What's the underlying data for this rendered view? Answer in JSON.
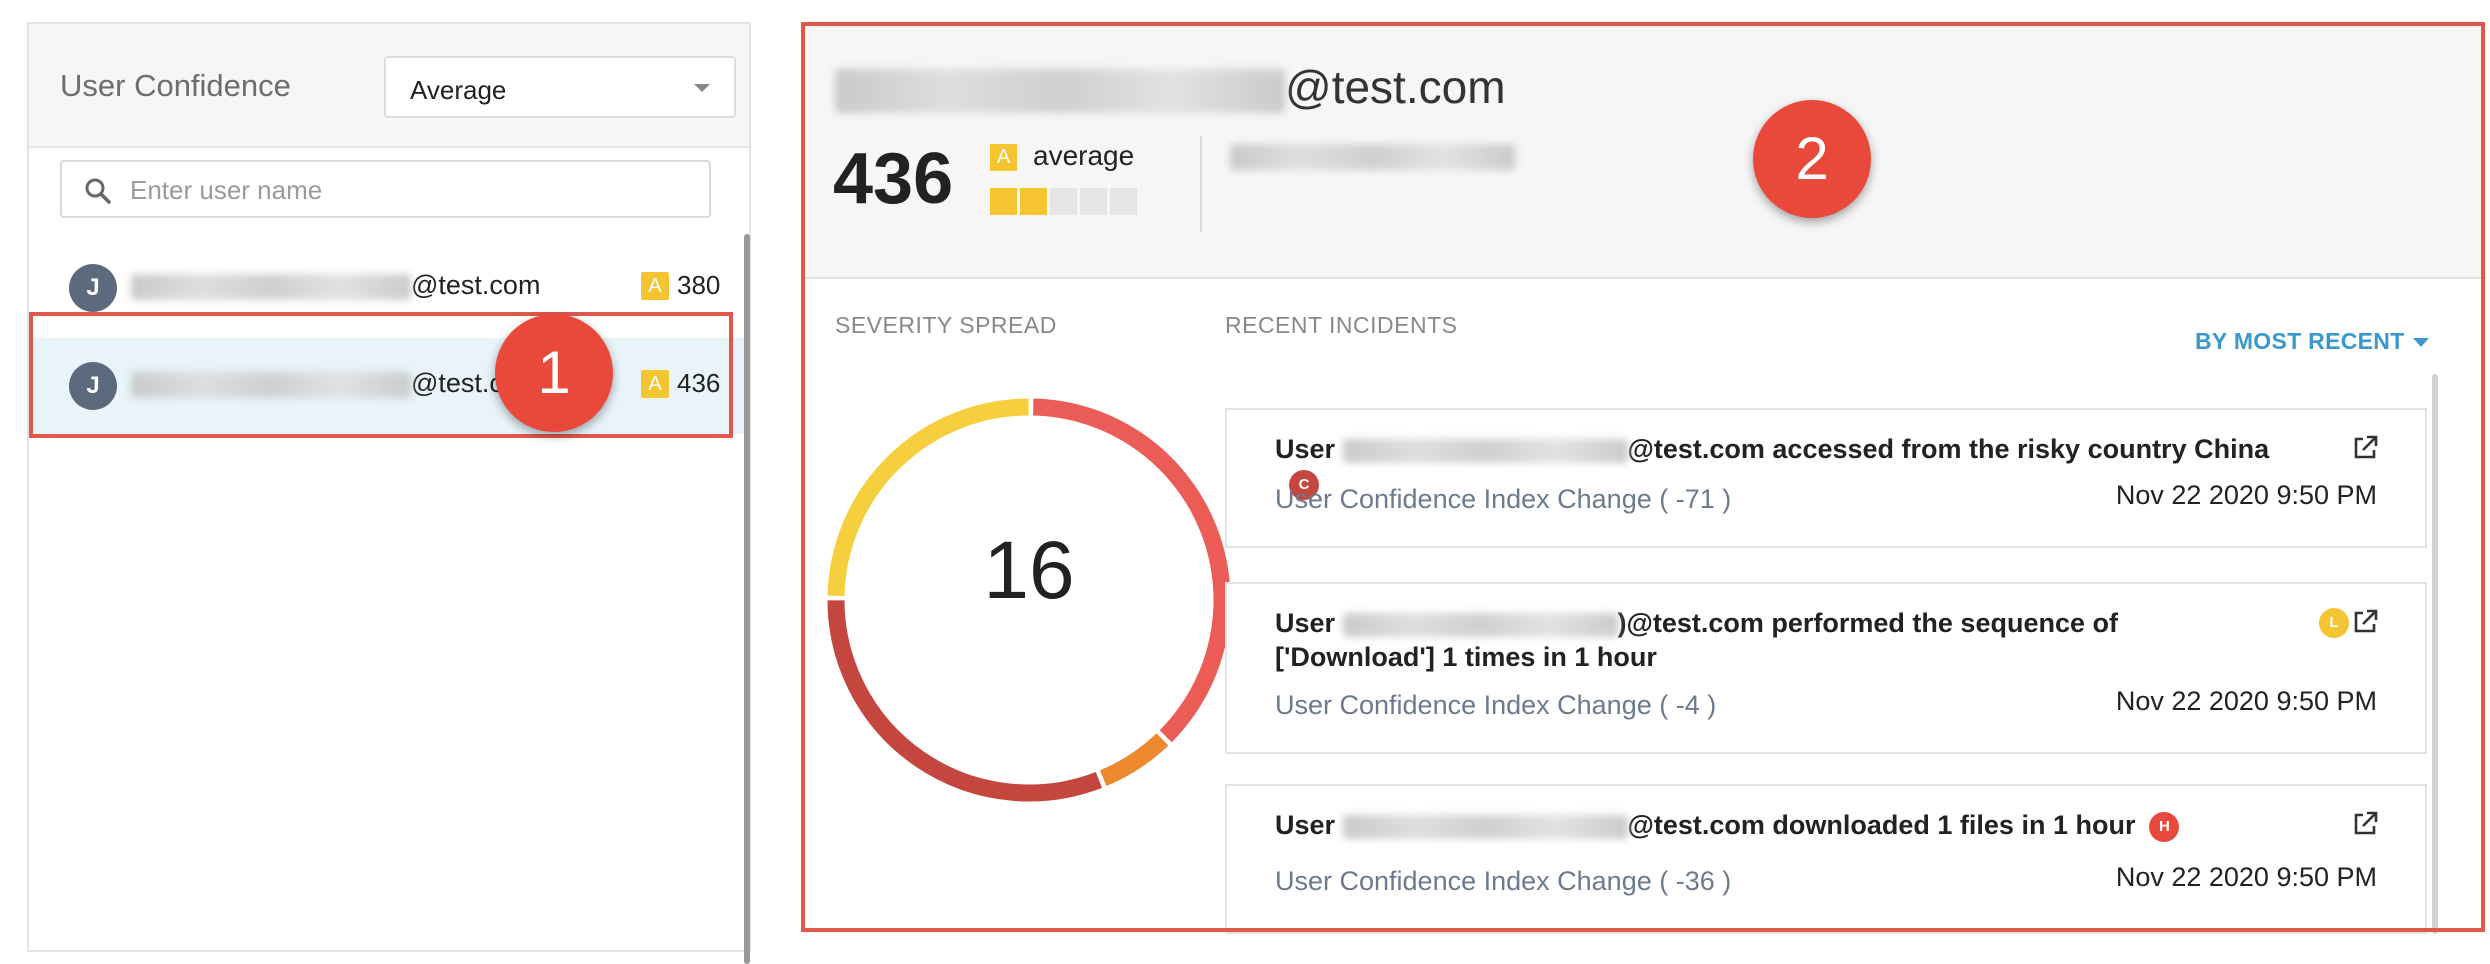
{
  "left_panel": {
    "title": "User Confidence",
    "filter": {
      "selected": "Average"
    },
    "search": {
      "placeholder": "Enter user name",
      "value": ""
    },
    "users": [
      {
        "initial": "J",
        "email_suffix": "@test.com",
        "grade": "A",
        "score": "380"
      },
      {
        "initial": "J",
        "email_suffix": "@test.co",
        "grade": "A",
        "score": "436"
      }
    ]
  },
  "markers": {
    "one": "1",
    "two": "2"
  },
  "detail": {
    "email_suffix": "@test.com",
    "score": "436",
    "grade": "A",
    "grade_label": "average",
    "grade_level": 2,
    "grade_level_max": 5,
    "severity_label": "SEVERITY SPREAD",
    "incidents_label": "RECENT INCIDENTS",
    "sort_label": "BY MOST RECENT",
    "total_incidents": "16"
  },
  "severity_spread": {
    "segments": [
      {
        "severity": "high",
        "color": "#ea5c55",
        "value": 6
      },
      {
        "severity": "medium",
        "color": "#ed8a2f",
        "value": 1
      },
      {
        "severity": "critical",
        "color": "#c4463f",
        "value": 5
      },
      {
        "severity": "low",
        "color": "#f6cf3f",
        "value": 4
      }
    ]
  },
  "incidents": [
    {
      "prefix": "User ",
      "suffix": "@test.com accessed from the risky country China",
      "severity_letter": "C",
      "severity_color": "#c4463f",
      "change": "User Confidence Index Change ( -71 )",
      "date": "Nov 22 2020 9:50 PM"
    },
    {
      "prefix": "User ",
      "suffix": ")@test.com performed the sequence of ['Download'] 1 times in 1 hour",
      "severity_letter": "L",
      "severity_color": "#f4c431",
      "change": "User Confidence Index Change ( -4 )",
      "date": "Nov 22 2020 9:50 PM"
    },
    {
      "prefix": "User ",
      "suffix": "@test.com downloaded 1 files in 1 hour",
      "severity_letter": "H",
      "severity_color": "#e8493b",
      "change": "User Confidence Index Change ( -36 )",
      "date": "Nov 22 2020 9:50 PM"
    }
  ]
}
